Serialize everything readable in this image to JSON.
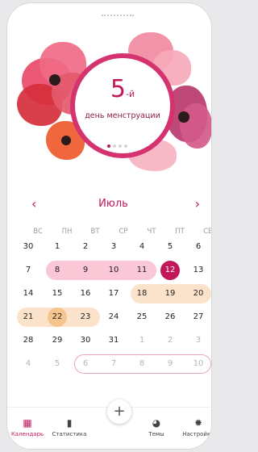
{
  "hero": {
    "day_number": "5",
    "day_suffix": "-й",
    "day_text": "день менструации",
    "page_dots": 4,
    "active_dot": 0
  },
  "calendar": {
    "month": "Июль",
    "prev_icon": "chevron-left-icon",
    "next_icon": "chevron-right-icon",
    "weekdays": [
      "ВС",
      "ПН",
      "ВТ",
      "СР",
      "ЧТ",
      "ПТ",
      "СБ"
    ],
    "weeks": [
      [
        {
          "d": "30",
          "m": false
        },
        {
          "d": "1",
          "m": false
        },
        {
          "d": "2",
          "m": false
        },
        {
          "d": "3",
          "m": false
        },
        {
          "d": "4",
          "m": false
        },
        {
          "d": "5",
          "m": false
        },
        {
          "d": "6",
          "m": false
        }
      ],
      [
        {
          "d": "7",
          "m": false
        },
        {
          "d": "8",
          "m": false
        },
        {
          "d": "9",
          "m": false
        },
        {
          "d": "10",
          "m": false
        },
        {
          "d": "11",
          "m": false
        },
        {
          "d": "12",
          "m": false,
          "today": true
        },
        {
          "d": "13",
          "m": false
        }
      ],
      [
        {
          "d": "14",
          "m": false
        },
        {
          "d": "15",
          "m": false
        },
        {
          "d": "16",
          "m": false
        },
        {
          "d": "17",
          "m": false
        },
        {
          "d": "18",
          "m": false
        },
        {
          "d": "19",
          "m": false
        },
        {
          "d": "20",
          "m": false
        }
      ],
      [
        {
          "d": "21",
          "m": false
        },
        {
          "d": "22",
          "m": false,
          "ovulation": true
        },
        {
          "d": "23",
          "m": false
        },
        {
          "d": "24",
          "m": false
        },
        {
          "d": "25",
          "m": false
        },
        {
          "d": "26",
          "m": false
        },
        {
          "d": "27",
          "m": false
        }
      ],
      [
        {
          "d": "28",
          "m": false
        },
        {
          "d": "29",
          "m": false
        },
        {
          "d": "30",
          "m": false
        },
        {
          "d": "31",
          "m": false
        },
        {
          "d": "1",
          "m": true
        },
        {
          "d": "2",
          "m": true
        },
        {
          "d": "3",
          "m": true
        }
      ],
      [
        {
          "d": "4",
          "m": true
        },
        {
          "d": "5",
          "m": true
        },
        {
          "d": "6",
          "m": true
        },
        {
          "d": "7",
          "m": true
        },
        {
          "d": "8",
          "m": true
        },
        {
          "d": "9",
          "m": true
        },
        {
          "d": "10",
          "m": true
        }
      ]
    ],
    "colors": {
      "period": "#f9c7d6",
      "fertile": "#fbe3cb",
      "ovulation": "#f5c48f",
      "today": "#c2185b",
      "predicted_outline": "#e8a5bc"
    }
  },
  "nav": {
    "items": [
      {
        "label": "Календарь",
        "icon": "calendar-icon",
        "active": true
      },
      {
        "label": "Статистика",
        "icon": "bar-chart-icon",
        "active": false
      },
      {
        "label": "Темы",
        "icon": "palette-icon",
        "active": false
      },
      {
        "label": "Настройки",
        "icon": "gear-icon",
        "active": false
      }
    ],
    "add_label": "+"
  }
}
